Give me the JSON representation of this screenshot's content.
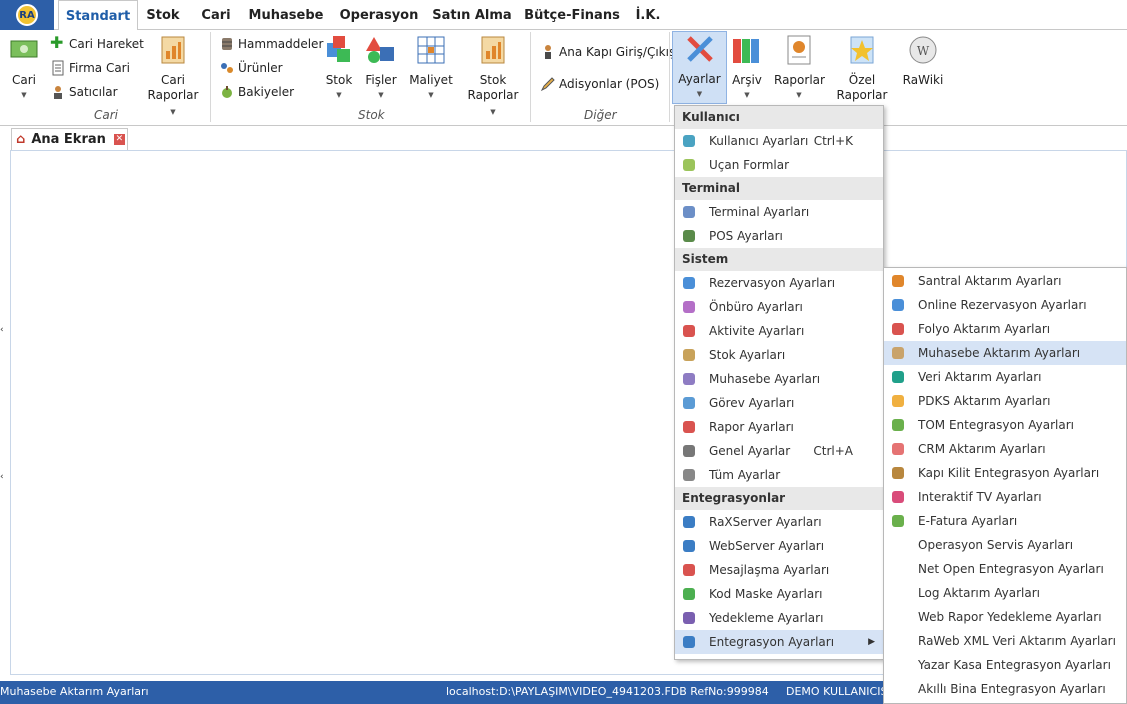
{
  "tabs": [
    "Standart",
    "Stok",
    "Cari",
    "Muhasebe",
    "Operasyon",
    "Satın Alma",
    "Bütçe-Finans",
    "İ.K."
  ],
  "logo_text": "RA",
  "ribbon": {
    "cari": {
      "label": "Cari",
      "big": "Cari",
      "small": [
        "Cari Hareket",
        "Firma Cari",
        "Satıcılar"
      ],
      "reports": [
        "Cari",
        "Raporlar"
      ]
    },
    "stok": {
      "label": "Stok",
      "small": [
        "Hammaddeler",
        "Ürünler",
        "Bakiyeler"
      ],
      "stok": "Stok",
      "fisler": "Fişler",
      "maliyet": "Maliyet",
      "reports": [
        "Stok",
        "Raporlar"
      ]
    },
    "diger": {
      "label": "Diğer",
      "small": [
        "Ana Kapı Giriş/Çıkış",
        "Adisyonlar (POS)"
      ]
    },
    "ayarlar": "Ayarlar",
    "arsiv": "Arşiv",
    "raporlar": "Raporlar",
    "ozel": [
      "Özel",
      "Raporlar"
    ],
    "rawiki": "RaWiki"
  },
  "doc_tab": "Ana Ekran",
  "menu": {
    "sections": [
      {
        "header": "Kullanıcı",
        "items": [
          {
            "label": "Kullanıcı Ayarları",
            "shortcut": "Ctrl+K",
            "icon": "user-icon"
          },
          {
            "label": "Uçan Formlar",
            "icon": "form-icon"
          }
        ]
      },
      {
        "header": "Terminal",
        "items": [
          {
            "label": "Terminal Ayarları",
            "icon": "terminal-icon"
          },
          {
            "label": "POS Ayarları",
            "icon": "pos-icon"
          }
        ]
      },
      {
        "header": "Sistem",
        "items": [
          {
            "label": "Rezervasyon Ayarları",
            "icon": "bed-icon"
          },
          {
            "label": "Önbüro Ayarları",
            "icon": "frontdesk-icon"
          },
          {
            "label": "Aktivite Ayarları",
            "icon": "activity-icon"
          },
          {
            "label": "Stok Ayarları",
            "icon": "hourglass-icon"
          },
          {
            "label": "Muhasebe Ayarları",
            "icon": "calculator-icon"
          },
          {
            "label": "Görev Ayarları",
            "icon": "clipboard-icon"
          },
          {
            "label": "Rapor Ayarları",
            "icon": "report-icon"
          },
          {
            "label": "Genel Ayarlar",
            "shortcut": "Ctrl+A",
            "icon": "tools-icon"
          },
          {
            "label": "Tüm Ayarlar",
            "icon": "gear-icon"
          }
        ]
      },
      {
        "header": "Entegrasyonlar",
        "items": [
          {
            "label": "RaXServer Ayarları",
            "icon": "server-icon"
          },
          {
            "label": "WebServer Ayarları",
            "icon": "network-icon"
          },
          {
            "label": "Mesajlaşma Ayarları",
            "icon": "mail-icon"
          },
          {
            "label": "Kod Maske Ayarları",
            "icon": "signal-icon"
          },
          {
            "label": "Yedekleme Ayarları",
            "icon": "cloud-upload-icon"
          },
          {
            "label": "Entegrasyon Ayarları",
            "icon": "puzzle-icon"
          }
        ]
      }
    ]
  },
  "submenu": [
    {
      "label": "Santral Aktarım Ayarları",
      "icon": "headset-icon"
    },
    {
      "label": "Online Rezervasyon Ayarları",
      "icon": "globe-icon"
    },
    {
      "label": "Folyo Aktarım Ayarları",
      "icon": "folio-icon"
    },
    {
      "label": "Muhasebe Aktarım Ayarları",
      "icon": "ledger-icon"
    },
    {
      "label": "Veri Aktarım Ayarları",
      "icon": "upload-icon"
    },
    {
      "label": "PDKS Aktarım Ayarları",
      "icon": "hand-icon"
    },
    {
      "label": "TOM Entegrasyon Ayarları",
      "icon": "link-icon"
    },
    {
      "label": "CRM Aktarım Ayarları",
      "icon": "people-icon"
    },
    {
      "label": "Kapı Kilit Entegrasyon Ayarları",
      "icon": "key-icon"
    },
    {
      "label": "Interaktif TV Ayarları",
      "icon": "tv-icon"
    },
    {
      "label": "E-Fatura Ayarları",
      "icon": "leaf-icon"
    },
    {
      "label": "Operasyon Servis Ayarları",
      "icon": ""
    },
    {
      "label": "Net Open Entegrasyon Ayarları",
      "icon": ""
    },
    {
      "label": "Log Aktarım Ayarları",
      "icon": ""
    },
    {
      "label": "Web Rapor Yedekleme Ayarları",
      "icon": ""
    },
    {
      "label": "RaWeb XML Veri Aktarım Ayarları",
      "icon": ""
    },
    {
      "label": "Yazar Kasa Entegrasyon Ayarları",
      "icon": ""
    },
    {
      "label": "Akıllı Bina Entegrasyon Ayarları",
      "icon": ""
    }
  ],
  "status": {
    "left": "Muhasebe Aktarım Ayarları",
    "db": "localhost:D:\\PAYLAŞIM\\VIDEO_4941203.FDB RefNo:999984",
    "user": "DEMO KULLANICISI/"
  },
  "colors": {
    "accent": "#2d5fa8",
    "highlight": "#d6e3f5"
  }
}
